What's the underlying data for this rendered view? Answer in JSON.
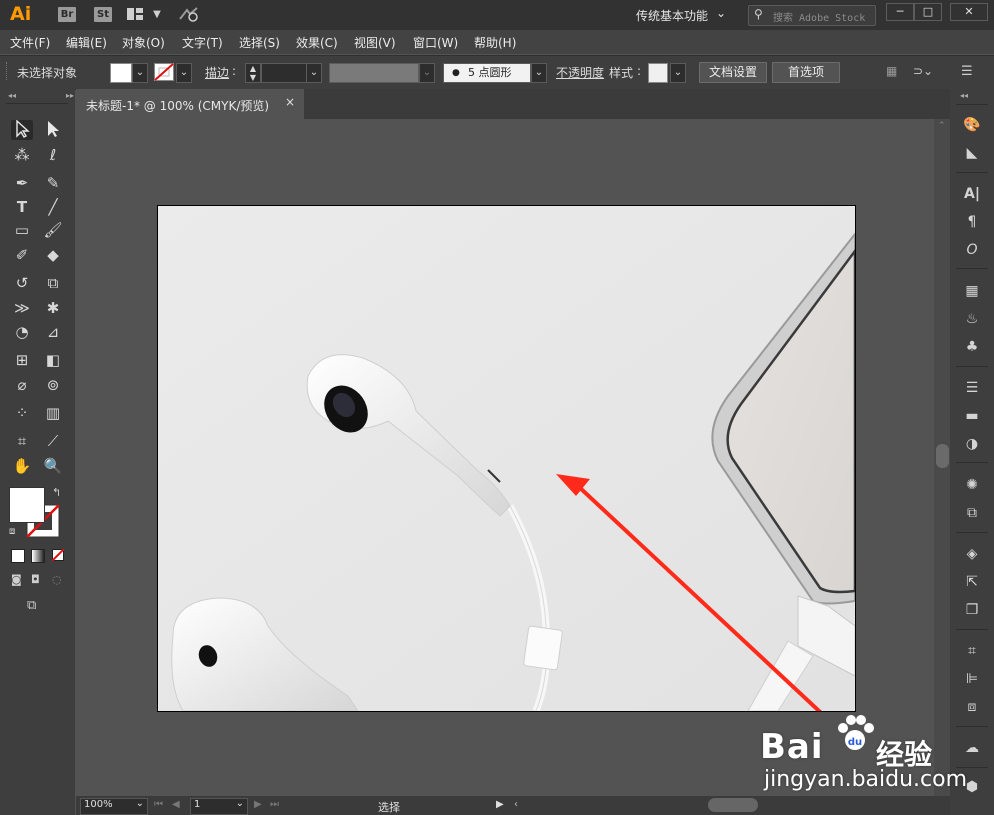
{
  "app": {
    "logo": "Ai",
    "badges": [
      "Br",
      "St"
    ],
    "workspace": "传统基本功能",
    "stock_placeholder": "搜索 Adobe Stock",
    "window_buttons": [
      "─",
      "□",
      "✕"
    ]
  },
  "menu": [
    "文件(F)",
    "编辑(E)",
    "对象(O)",
    "文字(T)",
    "选择(S)",
    "效果(C)",
    "视图(V)",
    "窗口(W)",
    "帮助(H)"
  ],
  "control": {
    "selection_status": "未选择对象",
    "stroke_label": "描边",
    "stroke_colon": ":",
    "brush": "5 点圆形",
    "opacity_label": "不透明度",
    "style_label": "样式",
    "style_colon": ":",
    "doc_setup": "文档设置",
    "preferences": "首选项"
  },
  "document": {
    "tab_title": "未标题-1* @ 100% (CMYK/预览)",
    "close": "×"
  },
  "status": {
    "zoom": "100%",
    "page": "1",
    "tool": "选择"
  },
  "watermark": {
    "main": "Bai",
    "du": "du",
    "cn": "经验",
    "url": "jingyan.baidu.com"
  },
  "colors": {
    "accent_logo": "#ff9a00",
    "arrow": "#ff2a1a"
  }
}
